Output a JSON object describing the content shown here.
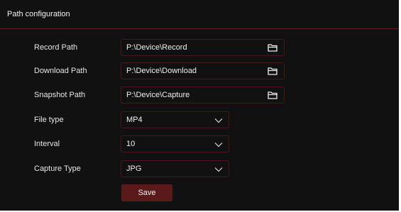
{
  "header": {
    "title": "Path configuration"
  },
  "rows": {
    "record_path": {
      "label": "Record Path",
      "value": "P:\\Device\\Record"
    },
    "download_path": {
      "label": "Download Path",
      "value": "P:\\Device\\Download"
    },
    "snapshot_path": {
      "label": "Snapshot Path",
      "value": "P:\\Device\\Capture"
    },
    "file_type": {
      "label": "File type",
      "value": "MP4"
    },
    "interval": {
      "label": "Interval",
      "value": "10"
    },
    "capture_type": {
      "label": "Capture Type",
      "value": "JPG"
    }
  },
  "actions": {
    "save_label": "Save"
  },
  "colors": {
    "background": "#111112",
    "field_border": "#4a1717",
    "header_divider": "#5a1f1f",
    "save_button": "#5a1a1a",
    "text": "#e6e6e6"
  },
  "icons": {
    "folder": "folder-icon",
    "dropdown": "chevron-down-icon"
  }
}
